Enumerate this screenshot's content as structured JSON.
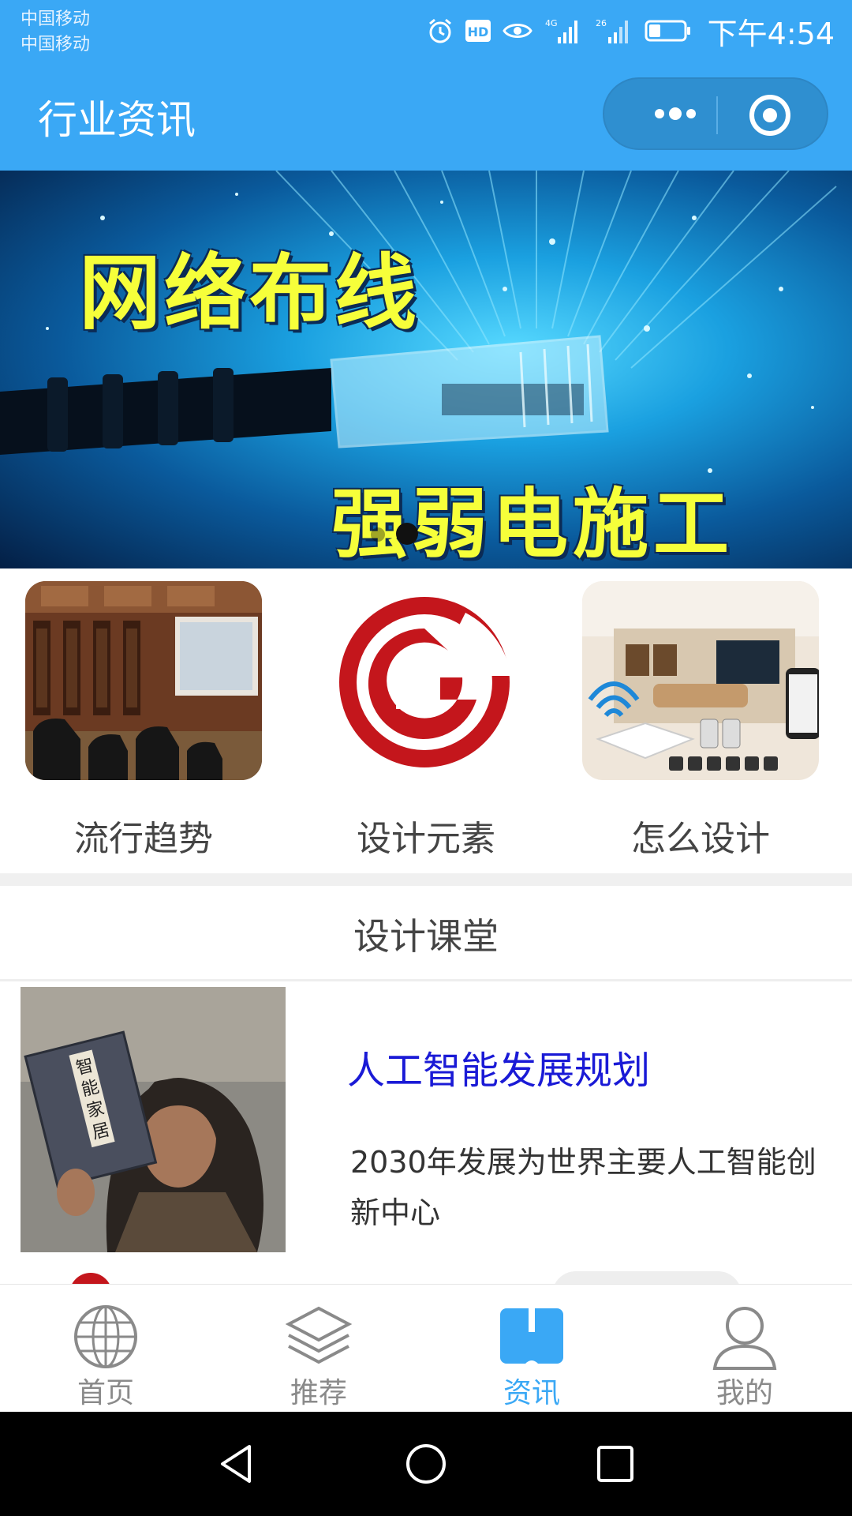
{
  "status_bar": {
    "carrier_1": "中国移动",
    "carrier_2": "中国移动",
    "hd_badge": "HD",
    "net_1": "4G",
    "net_2": "26",
    "time": "下午4:54",
    "icons": [
      "alarm-icon",
      "hd-icon",
      "eye-icon",
      "signal-4g-icon",
      "signal-26-icon",
      "battery-icon"
    ]
  },
  "header": {
    "title": "行业资讯",
    "more_icon": "more-dots-icon",
    "close_icon": "target-circle-icon",
    "bg_color": "#3aa8f5"
  },
  "banner": {
    "line1": "网络布线",
    "line2": "强弱电施工",
    "text_color": "#f6ff3a"
  },
  "categories": [
    {
      "label": "流行趋势",
      "image": "home-theater-photo"
    },
    {
      "label": "设计元素",
      "image": "red-g-logo"
    },
    {
      "label": "怎么设计",
      "image": "smart-home-diagram"
    }
  ],
  "section": {
    "title": "设计课堂"
  },
  "article": {
    "title": "人工智能发展规划",
    "description": "2030年发展为世界主要人工智能创新中心",
    "thumb_book_text": "智能家居",
    "title_color": "#1a1ad6"
  },
  "tabs": [
    {
      "label": "首页",
      "icon": "globe-icon",
      "active": false
    },
    {
      "label": "推荐",
      "icon": "layers-icon",
      "active": false
    },
    {
      "label": "资讯",
      "icon": "book-icon",
      "active": true
    },
    {
      "label": "我的",
      "icon": "person-icon",
      "active": false
    }
  ],
  "accent_color": "#3aa8f5"
}
